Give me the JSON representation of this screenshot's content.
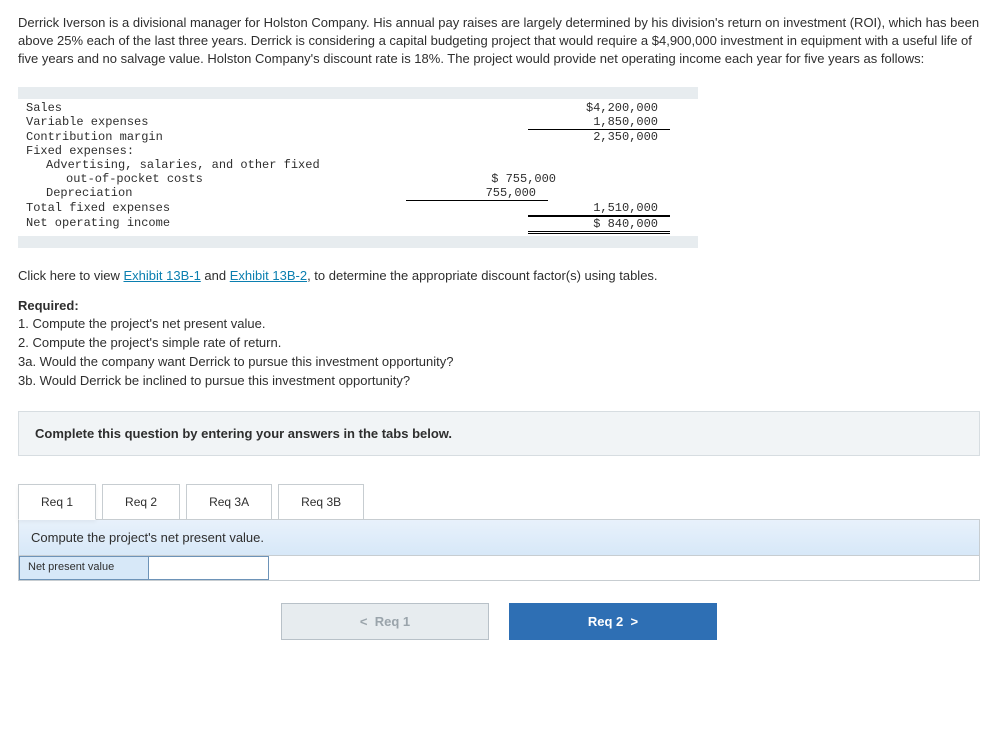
{
  "intro": "Derrick Iverson is a divisional manager for Holston Company. His annual pay raises are largely determined by his division's return on investment (ROI), which has been above 25% each of the last three years. Derrick is considering a capital budgeting project that would require a $4,900,000 investment in equipment with a useful life of five years and no salvage value. Holston Company's discount rate is 18%. The project would provide net operating income each year for five years as follows:",
  "income": {
    "sales_label": "Sales",
    "sales_value": "$4,200,000",
    "varexp_label": "Variable expenses",
    "varexp_value": "1,850,000",
    "cm_label": "Contribution margin",
    "cm_value": "2,350,000",
    "fixed_label": "Fixed expenses:",
    "adv_label": "Advertising, salaries, and other fixed",
    "adv_label2": "out-of-pocket costs",
    "adv_value": "$  755,000",
    "dep_label": "Depreciation",
    "dep_value": "755,000",
    "tfe_label": "Total fixed expenses",
    "tfe_value": "1,510,000",
    "noi_label": "Net operating income",
    "noi_value": "$  840,000"
  },
  "exhibit_text_pre": "Click here to view ",
  "exhibit1": "Exhibit 13B-1",
  "exhibit_and": " and ",
  "exhibit2": "Exhibit 13B-2",
  "exhibit_text_post": ", to determine the appropriate discount factor(s) using tables.",
  "required": {
    "heading": "Required:",
    "r1": "1. Compute the project's net present value.",
    "r2": "2. Compute the project's simple rate of return.",
    "r3a": "3a. Would the company want Derrick to pursue this investment opportunity?",
    "r3b": "3b. Would Derrick be inclined to pursue this investment opportunity?"
  },
  "instruct": "Complete this question by entering your answers in the tabs below.",
  "tabs": {
    "t1": "Req 1",
    "t2": "Req 2",
    "t3a": "Req 3A",
    "t3b": "Req 3B"
  },
  "panel_prompt": "Compute the project's net present value.",
  "answer_label": "Net present value",
  "answer_value": "",
  "nav": {
    "prev": "Req 1",
    "next": "Req 2"
  }
}
